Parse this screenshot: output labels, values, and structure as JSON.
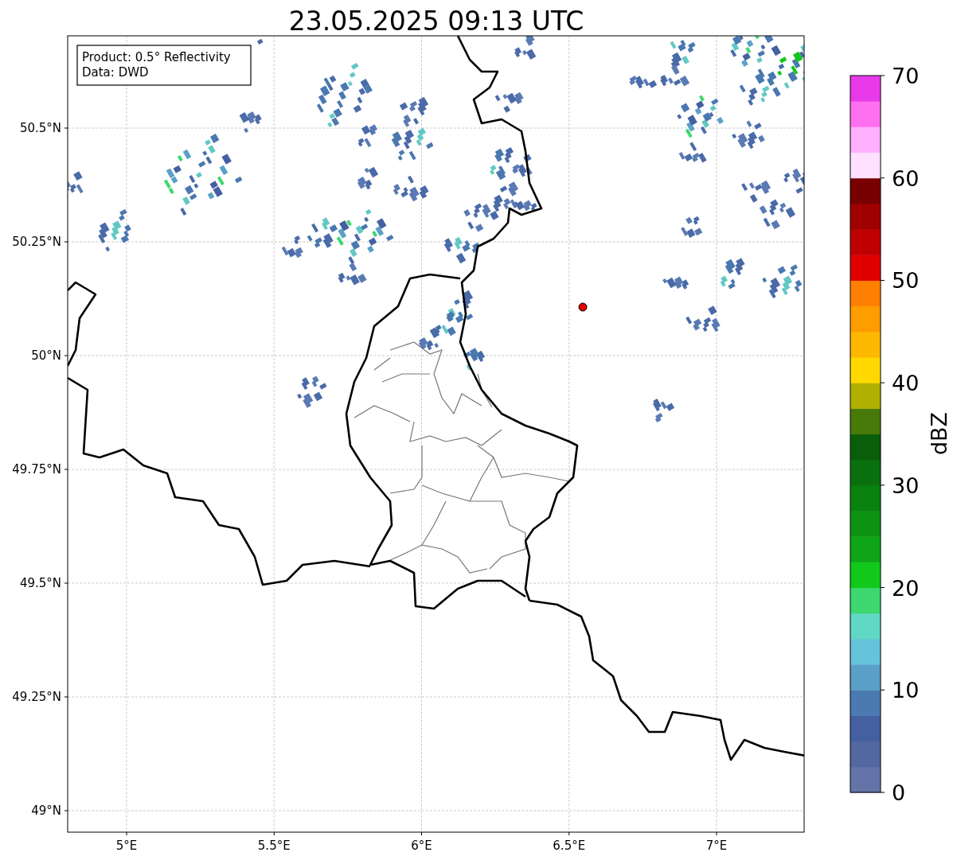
{
  "title": "23.05.2025 09:13 UTC",
  "info_box": {
    "lines": [
      "Product: 0.5° Reflectivity",
      "Data: DWD"
    ]
  },
  "y_axis": {
    "tick_labels": [
      "50.5°N",
      "50.25°N",
      "50°N",
      "49.75°N",
      "49.5°N",
      "49.25°N",
      "49°N"
    ]
  },
  "x_axis": {
    "tick_labels": [
      "5°E",
      "5.5°E",
      "6°E",
      "6.5°E",
      "7°E"
    ]
  },
  "colorbar": {
    "label": "dBZ",
    "tick_labels": [
      "70",
      "60",
      "50",
      "40",
      "30",
      "20",
      "10",
      "0"
    ],
    "segments": [
      {
        "color": "#6474a8"
      },
      {
        "color": "#5468a0"
      },
      {
        "color": "#4460a0"
      },
      {
        "color": "#4a7ab0"
      },
      {
        "color": "#5a9fc8"
      },
      {
        "color": "#66c3dc"
      },
      {
        "color": "#60d8c4"
      },
      {
        "color": "#3dd870"
      },
      {
        "color": "#12c81a"
      },
      {
        "color": "#0ea616"
      },
      {
        "color": "#0c9412"
      },
      {
        "color": "#0a8210"
      },
      {
        "color": "#0a700e"
      },
      {
        "color": "#0a5e0a"
      },
      {
        "color": "#487a0a"
      },
      {
        "color": "#b0b000"
      },
      {
        "color": "#ffd800"
      },
      {
        "color": "#ffb800"
      },
      {
        "color": "#ff9c00"
      },
      {
        "color": "#ff8000"
      },
      {
        "color": "#e00000"
      },
      {
        "color": "#c00000"
      },
      {
        "color": "#a00000"
      },
      {
        "color": "#780000"
      },
      {
        "color": "#ffe0ff"
      },
      {
        "color": "#ffb0ff"
      },
      {
        "color": "#ff70f0"
      },
      {
        "color": "#e83ae8"
      }
    ]
  }
}
